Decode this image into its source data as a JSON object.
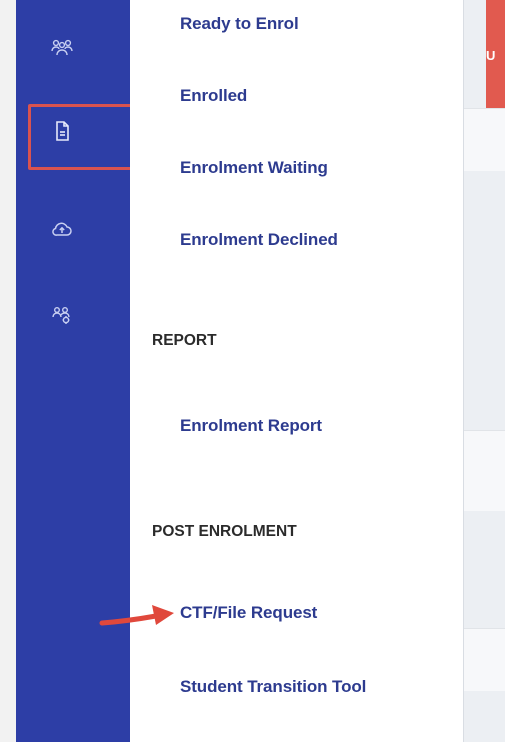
{
  "icon_rail": {
    "icons": [
      "users-group-icon",
      "document-icon",
      "cloud-upload-icon",
      "users-settings-icon"
    ],
    "selected_icon": "document-icon",
    "background": "#2d3ea6"
  },
  "nav": {
    "enrolment_items": [
      {
        "label": "Ready to Enrol"
      },
      {
        "label": "Enrolled"
      },
      {
        "label": "Enrolment Waiting"
      },
      {
        "label": "Enrolment Declined"
      }
    ],
    "report_section": {
      "heading": "REPORT",
      "items": [
        {
          "label": "Enrolment Report"
        }
      ]
    },
    "post_enrolment_section": {
      "heading": "POST ENROLMENT",
      "items": [
        {
          "label": "CTF/File Request"
        },
        {
          "label": "Student Transition Tool"
        }
      ]
    }
  },
  "right_panel": {
    "tab_label": "U"
  },
  "annotations": {
    "highlight_color": "#d9534f",
    "arrow_color": "#e0483c"
  },
  "colors": {
    "link": "#2d3b8f",
    "heading": "#2b2b2b",
    "accent_red": "#e15a4f"
  }
}
